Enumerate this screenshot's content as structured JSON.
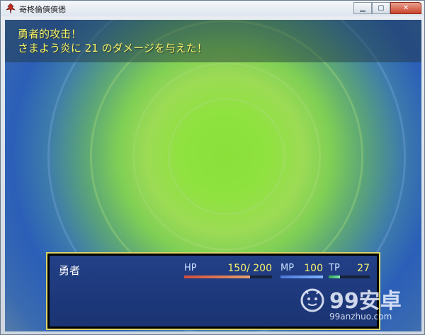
{
  "window": {
    "title": "嵜柊倫傸傸僁",
    "minimize_icon": "minimize-icon",
    "maximize_icon": "maximize-icon",
    "close_icon": "close-icon"
  },
  "battle": {
    "message_lines": [
      "勇者的攻击！",
      "さまよう炎に 21 のダメージを与えた！"
    ]
  },
  "party": [
    {
      "name": "勇者",
      "hp": {
        "label": "HP",
        "value": "150/ 200",
        "fraction": 0.75
      },
      "mp": {
        "label": "MP",
        "value": "100",
        "fraction": 1.0
      },
      "tp": {
        "label": "TP",
        "value": "27",
        "fraction": 0.27
      }
    }
  ],
  "watermark": {
    "title": "99安卓",
    "url": "99anzhuo.com"
  },
  "colors": {
    "message_text": "#f6f26c",
    "window_blue": "#233f86",
    "window_border": "#d8d36b",
    "hp_gauge": "#d24d3a",
    "mp_gauge": "#4c7ad8",
    "tp_gauge": "#2ea558"
  }
}
